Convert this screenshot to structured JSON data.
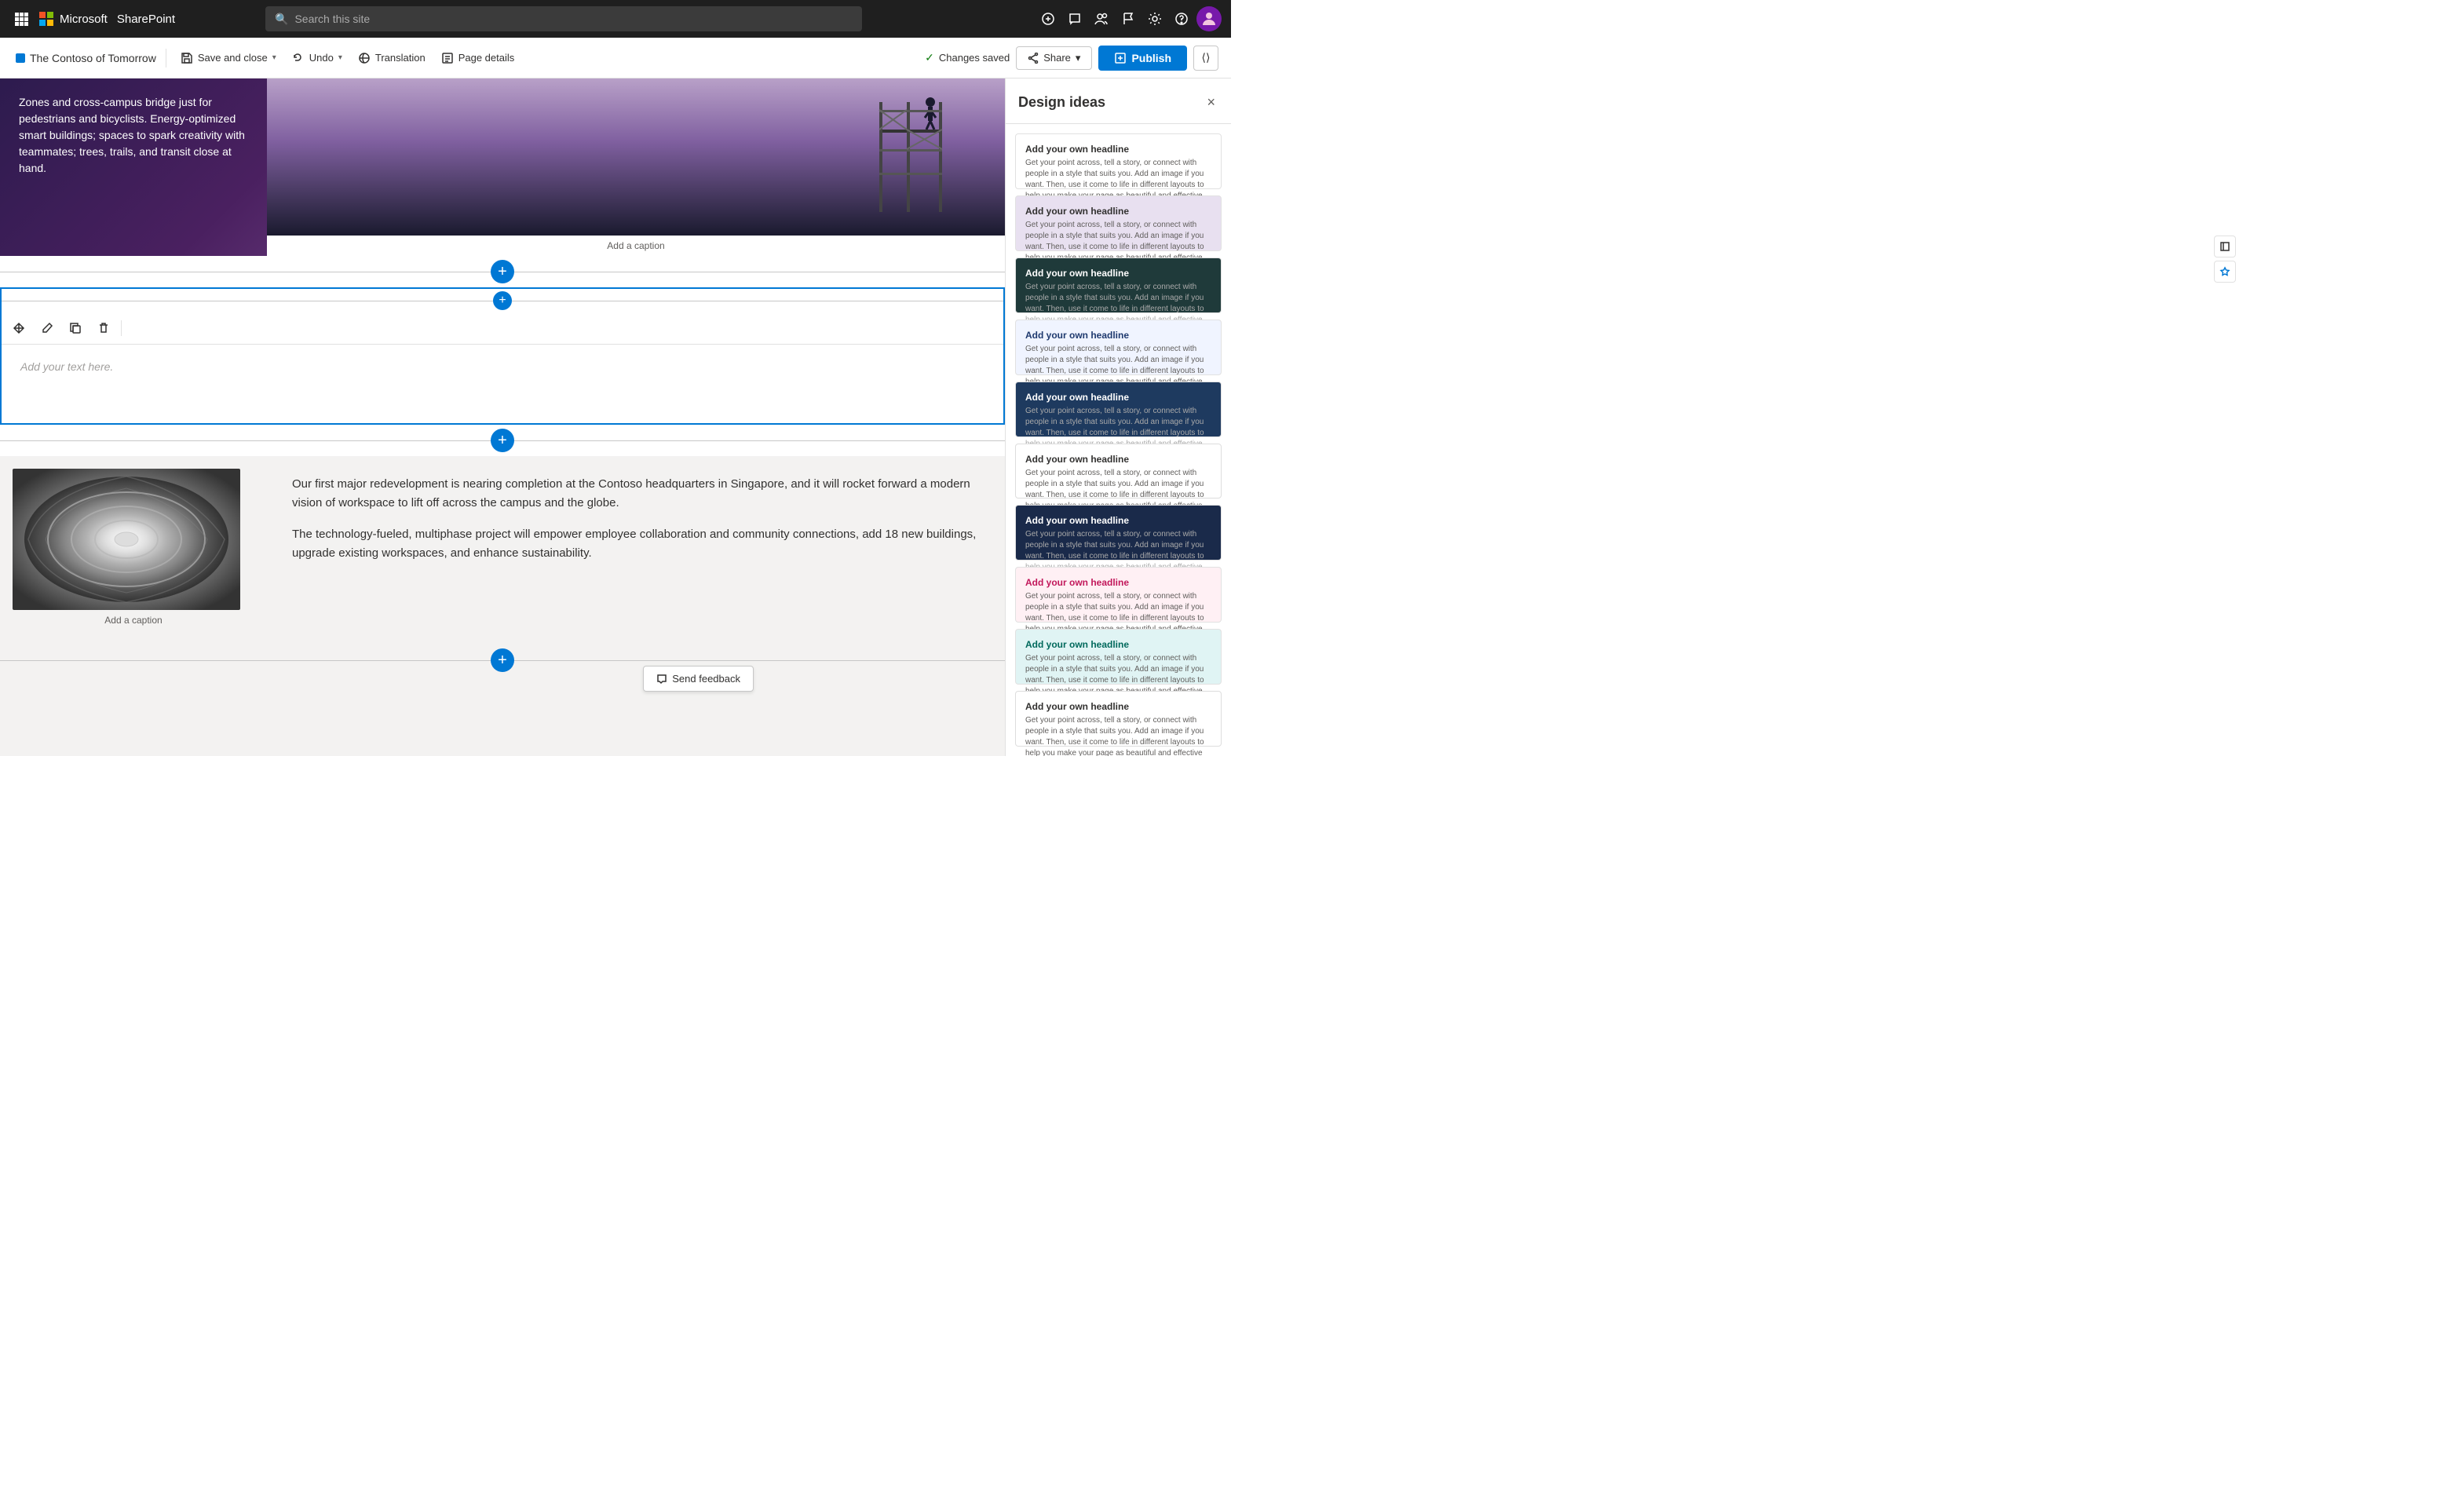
{
  "topNav": {
    "appsIcon": "⊞",
    "microsoft": "Microsoft",
    "sharepoint": "SharePoint",
    "search": {
      "placeholder": "Search this site",
      "value": ""
    },
    "icons": [
      "⚙",
      "💬",
      "👥",
      "⚑",
      "⚙",
      "?"
    ]
  },
  "toolbar": {
    "pageName": "The Contoso of Tomorrow",
    "saveAndClose": "Save and close",
    "undo": "Undo",
    "translation": "Translation",
    "pageDetails": "Page details",
    "changesSaved": "Changes saved",
    "share": "Share",
    "publish": "Publish"
  },
  "editor": {
    "darkSectionText": "Zones and cross-campus bridge just for pedestrians and bicyclists. Energy-optimized smart buildings; spaces to spark creativity with teammates; trees, trails, and transit close at hand.",
    "imageCaption1": "Add a caption",
    "textPlaceholder": "Add your text here.",
    "imageCaption2": "Add a caption",
    "paragraph1": "Our first major redevelopment is nearing completion at the Contoso headquarters in Singapore, and it will rocket forward a modern vision of workspace to lift off across the campus and the globe.",
    "paragraph2": "The technology-fueled, multiphase project will empower employee collaboration and community connections, add 18 new buildings, upgrade existing workspaces, and enhance sustainability."
  },
  "designPanel": {
    "title": "Design ideas",
    "closeLabel": "×",
    "cards": [
      {
        "id": "card1",
        "style": "white",
        "title": "Add your own headline",
        "subtitle": "Get your point across, tell a story, or connect with people in a style that suits you. Add an image if you want. Then, use it come to life in different layouts to help you make your page as beautiful and effective as possible."
      },
      {
        "id": "card2",
        "style": "lavender",
        "title": "Add your own headline",
        "subtitle": "Get your point across, tell a story, or connect with people in a style that suits you. Add an image if you want. Then, use it come to life in different layouts to help you make your page as beautiful and effective as possible."
      },
      {
        "id": "card3",
        "style": "dark-teal",
        "title": "Add your own headline",
        "subtitle": "Get your point across, tell a story, or connect with people in a style that suits you. Add an image if you want. Then, use it come to life in different layouts to help you make your page as beautiful and effective as possible."
      },
      {
        "id": "card4",
        "style": "light-blue",
        "title": "Add your own headline",
        "subtitle": "Get your point across, tell a story, or connect with people in a style that suits you. Add an image if you want. Then use it come to life in different layouts to help you make your page as beautiful and effective as possible."
      },
      {
        "id": "card5",
        "style": "dark-blue",
        "title": "Add your own headline",
        "subtitle": "Get your point across, tell a story, or connect with people in a style that suits you. Add an image if you want. Then, use it come to life in different layouts to help you make your page as beautiful and effective as possible."
      },
      {
        "id": "card6",
        "style": "minimal",
        "title": "Add your own headline",
        "subtitle": "Get your point across, tell a story, or connect with people in a style that suits you. Add an image if you want. Then, use it come to life in different layouts to help you make your page as beautiful and effective as possible."
      },
      {
        "id": "card7",
        "style": "navy",
        "title": "Add your own headline",
        "subtitle": "Get your point across, tell a story, or connect with people in a style that suits you. Add an image if you want. Then, use it come to life in different layouts to help you make your page as beautiful and effective as possible."
      },
      {
        "id": "card8",
        "style": "pink",
        "title": "Add your own headline",
        "subtitle": "Get your point across, tell a story, or connect with people in a style that suits you. Add an image if you want. Then, use it come to life in different layouts to help you make your page as beautiful and effective as possible."
      },
      {
        "id": "card9",
        "style": "teal-green",
        "title": "Add your own headline",
        "subtitle": "Get your point across, tell a story, or connect with people in a style that suits you. Add an image if you want. Then, use it come to life in different layouts to help you make your page as beautiful and effective as possible."
      },
      {
        "id": "card10",
        "style": "white-bottom",
        "title": "Add your own headline",
        "subtitle": "Get your point across, tell a story, or connect with people in a style that suits you. Add an image if you want. Then, use it come to life in different layouts to help you make your page as beautiful and effective as possible."
      }
    ]
  },
  "feedback": {
    "label": "Send feedback"
  }
}
